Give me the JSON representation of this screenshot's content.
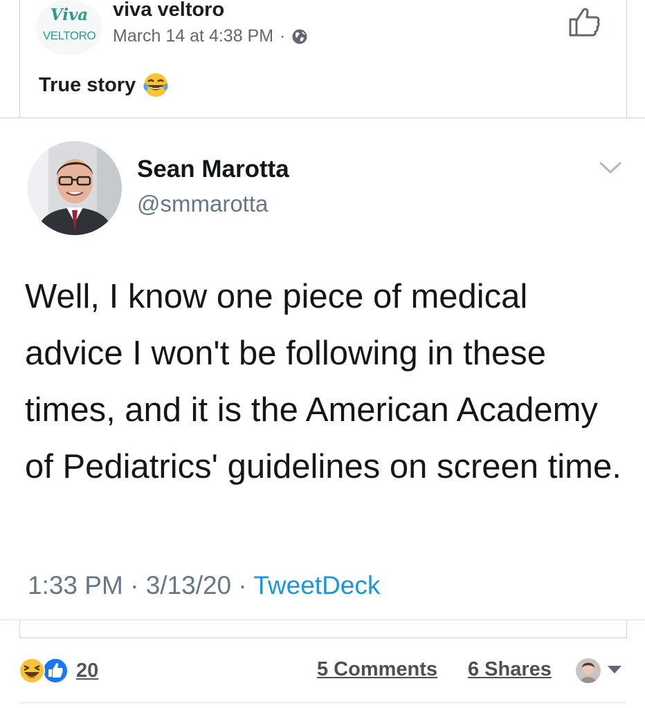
{
  "post": {
    "logo_line1": "Viva",
    "logo_line2": "VELTORO",
    "author": "viva veltoro",
    "timestamp": "March 14 at 4:38 PM",
    "separator": "·",
    "privacy_icon": "globe-icon",
    "caption": "True story",
    "caption_emoji": "face-with-tears-of-joy"
  },
  "tweet": {
    "name": "Sean Marotta",
    "handle": "@smmarotta",
    "text": "Well, I know one piece of medical advice I won't be following in these times, and it is the American Academy of Pediatrics' guidelines on screen time.",
    "time": "1:33 PM",
    "date": "3/13/20",
    "separator": "·",
    "source": "TweetDeck"
  },
  "footer": {
    "reaction_icons": [
      "haha-reaction-icon",
      "like-reaction-icon"
    ],
    "reaction_count": "20",
    "comments": "5 Comments",
    "shares": "6 Shares"
  },
  "colors": {
    "brand_teal": "#2e9a8b",
    "twitter_blue": "#1b95e0",
    "like_blue": "#1877f2",
    "meta_gray": "#606770"
  }
}
